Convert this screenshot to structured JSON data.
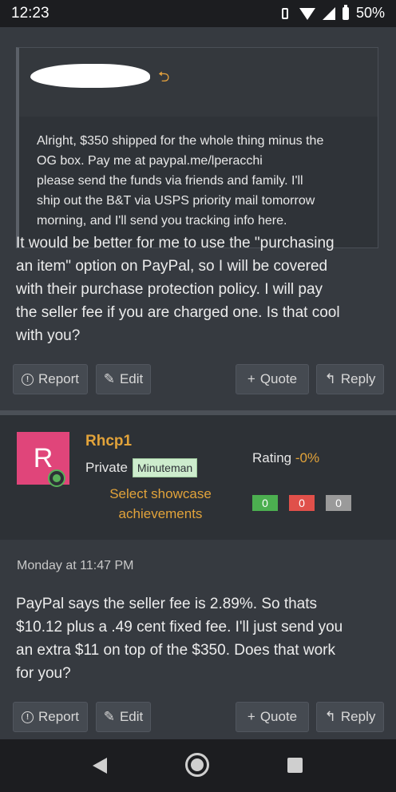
{
  "status_bar": {
    "time": "12:23",
    "battery": "50%"
  },
  "post1": {
    "quote_arrow": "⮌",
    "quote_text_lines": [
      "Alright, $350 shipped for the whole thing minus the",
      "OG box. Pay me at paypal.me/lperacchi",
      "please send the funds via friends and family. I'll",
      "ship out the B&T via USPS priority mail tomorrow",
      "morning, and I'll send you tracking info here."
    ],
    "body_lines": [
      "It would be better for me to use the \"purchasing",
      "an item\" option on PayPal, so I will be covered",
      "with their purchase protection policy. I will pay",
      "the seller fee if you are charged one. Is that cool",
      "with you?"
    ],
    "actions": {
      "report": "Report",
      "edit": "Edit",
      "quote": "Quote",
      "reply": "Reply"
    }
  },
  "post2": {
    "user": {
      "avatar_letter": "R",
      "name": "Rhcp1",
      "rank": "Private",
      "badge": "Minuteman",
      "showcase_line1": "Select showcase",
      "showcase_line2": "achievements",
      "rating_label": "Rating",
      "rating_value": "-0%",
      "votes": {
        "positive": "0",
        "negative": "0",
        "neutral": "0"
      }
    },
    "timestamp": "Monday at 11:47 PM",
    "body_lines": [
      "PayPal says the seller fee is 2.89%. So thats",
      "$10.12 plus a .49 cent fixed fee. I'll just send you",
      "an extra $11 on top of the $350. Does that work",
      "for you?"
    ],
    "actions": {
      "report": "Report",
      "edit": "Edit",
      "quote": "Quote",
      "reply": "Reply"
    }
  },
  "colors": {
    "accent": "#e2a33a",
    "avatar": "#e0457a",
    "positive": "#4caf50",
    "negative": "#e0504a",
    "neutral": "#9a9a9a"
  }
}
